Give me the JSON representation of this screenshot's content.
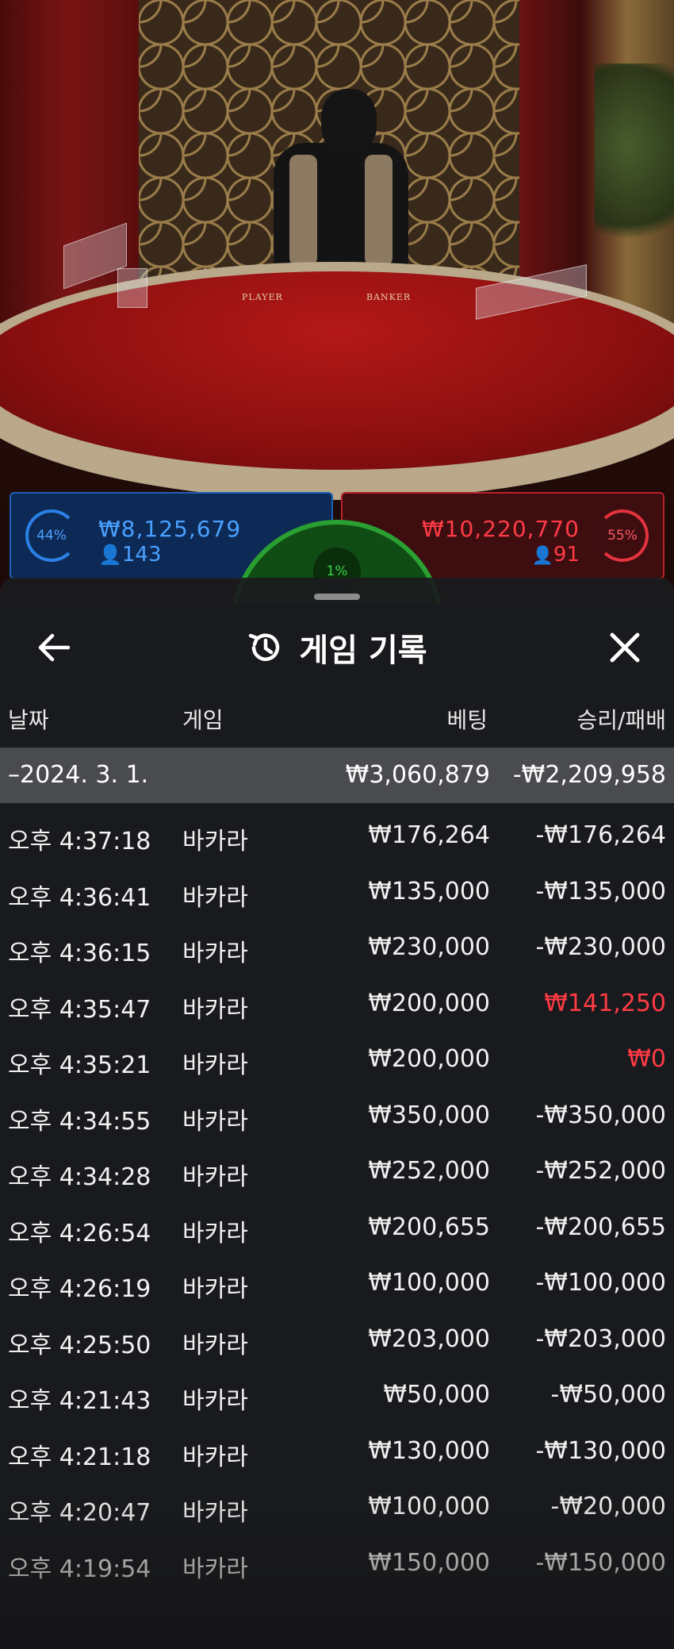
{
  "video": {
    "felt_player": "PLAYER",
    "felt_banker": "BANKER"
  },
  "bets": {
    "player": {
      "percent": "44%",
      "amount": "₩8,125,679",
      "count": "143",
      "color": "#2b80e6"
    },
    "tie": {
      "percent": "1%",
      "color": "#2aa032"
    },
    "banker": {
      "percent": "55%",
      "amount": "₩10,220,770",
      "count": "91",
      "color": "#e3333d"
    }
  },
  "panel": {
    "title": "게임 기록",
    "icons": {
      "back": "arrow-left-icon",
      "history": "history-clock-icon",
      "close": "close-icon"
    },
    "columns": {
      "date": "날짜",
      "game": "게임",
      "bet": "베팅",
      "win_loss": "승리/패배"
    },
    "summary": {
      "date": "–2024. 3. 1.",
      "bet": "₩3,060,879",
      "win_loss": "-₩2,209,958"
    },
    "rows": [
      {
        "time": "오후 4:37:18",
        "game": "바카라",
        "bet": "₩176,264",
        "result": "-₩176,264",
        "win": false
      },
      {
        "time": "오후 4:36:41",
        "game": "바카라",
        "bet": "₩135,000",
        "result": "-₩135,000",
        "win": false
      },
      {
        "time": "오후 4:36:15",
        "game": "바카라",
        "bet": "₩230,000",
        "result": "-₩230,000",
        "win": false
      },
      {
        "time": "오후 4:35:47",
        "game": "바카라",
        "bet": "₩200,000",
        "result": "₩141,250",
        "win": true
      },
      {
        "time": "오후 4:35:21",
        "game": "바카라",
        "bet": "₩200,000",
        "result": "₩0",
        "win": true
      },
      {
        "time": "오후 4:34:55",
        "game": "바카라",
        "bet": "₩350,000",
        "result": "-₩350,000",
        "win": false
      },
      {
        "time": "오후 4:34:28",
        "game": "바카라",
        "bet": "₩252,000",
        "result": "-₩252,000",
        "win": false
      },
      {
        "time": "오후 4:26:54",
        "game": "바카라",
        "bet": "₩200,655",
        "result": "-₩200,655",
        "win": false
      },
      {
        "time": "오후 4:26:19",
        "game": "바카라",
        "bet": "₩100,000",
        "result": "-₩100,000",
        "win": false
      },
      {
        "time": "오후 4:25:50",
        "game": "바카라",
        "bet": "₩203,000",
        "result": "-₩203,000",
        "win": false
      },
      {
        "time": "오후 4:21:43",
        "game": "바카라",
        "bet": "₩50,000",
        "result": "-₩50,000",
        "win": false
      },
      {
        "time": "오후 4:21:18",
        "game": "바카라",
        "bet": "₩130,000",
        "result": "-₩130,000",
        "win": false
      },
      {
        "time": "오후 4:20:47",
        "game": "바카라",
        "bet": "₩100,000",
        "result": "-₩20,000",
        "win": false
      },
      {
        "time": "오후 4:19:54",
        "game": "바카라",
        "bet": "₩150,000",
        "result": "-₩150,000",
        "win": false
      }
    ]
  }
}
